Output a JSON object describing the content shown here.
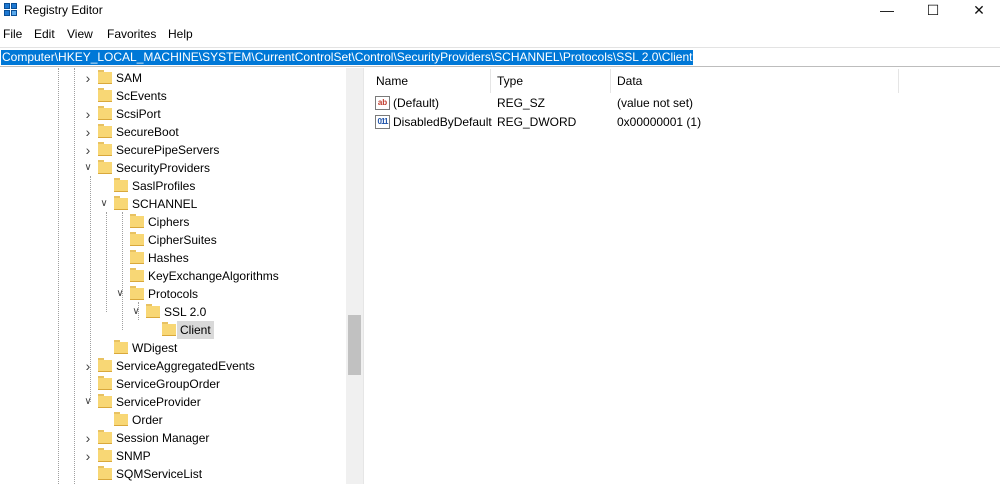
{
  "window": {
    "title": "Registry Editor",
    "minimize_glyph": "—",
    "maximize_glyph": "☐",
    "close_glyph": "✕",
    "icon": "registry-editor-icon"
  },
  "menu": {
    "file": "File",
    "edit": "Edit",
    "view": "View",
    "favorites": "Favorites",
    "help": "Help"
  },
  "address": {
    "path": "Computer\\HKEY_LOCAL_MACHINE\\SYSTEM\\CurrentControlSet\\Control\\SecurityProviders\\SCHANNEL\\Protocols\\SSL 2.0\\Client"
  },
  "tree": {
    "items": [
      {
        "label": "SAM",
        "depth": 0,
        "expander": "collapsed"
      },
      {
        "label": "ScEvents",
        "depth": 0,
        "expander": "none"
      },
      {
        "label": "ScsiPort",
        "depth": 0,
        "expander": "collapsed"
      },
      {
        "label": "SecureBoot",
        "depth": 0,
        "expander": "collapsed"
      },
      {
        "label": "SecurePipeServers",
        "depth": 0,
        "expander": "collapsed"
      },
      {
        "label": "SecurityProviders",
        "depth": 0,
        "expander": "expanded"
      },
      {
        "label": "SaslProfiles",
        "depth": 1,
        "expander": "none"
      },
      {
        "label": "SCHANNEL",
        "depth": 1,
        "expander": "expanded"
      },
      {
        "label": "Ciphers",
        "depth": 2,
        "expander": "none"
      },
      {
        "label": "CipherSuites",
        "depth": 2,
        "expander": "none"
      },
      {
        "label": "Hashes",
        "depth": 2,
        "expander": "none"
      },
      {
        "label": "KeyExchangeAlgorithms",
        "depth": 2,
        "expander": "none"
      },
      {
        "label": "Protocols",
        "depth": 2,
        "expander": "expanded"
      },
      {
        "label": "SSL 2.0",
        "depth": 3,
        "expander": "expanded"
      },
      {
        "label": "Client",
        "depth": 4,
        "expander": "none",
        "selected": true
      },
      {
        "label": "WDigest",
        "depth": 1,
        "expander": "none"
      },
      {
        "label": "ServiceAggregatedEvents",
        "depth": 0,
        "expander": "collapsed"
      },
      {
        "label": "ServiceGroupOrder",
        "depth": 0,
        "expander": "none"
      },
      {
        "label": "ServiceProvider",
        "depth": 0,
        "expander": "expanded"
      },
      {
        "label": "Order",
        "depth": 1,
        "expander": "none"
      },
      {
        "label": "Session Manager",
        "depth": 0,
        "expander": "collapsed"
      },
      {
        "label": "SNMP",
        "depth": 0,
        "expander": "collapsed"
      },
      {
        "label": "SQMServiceList",
        "depth": 0,
        "expander": "none"
      }
    ]
  },
  "values": {
    "columns": {
      "name": "Name",
      "type": "Type",
      "data": "Data"
    },
    "rows": [
      {
        "name": "(Default)",
        "type": "REG_SZ",
        "data": "(value not set)",
        "icon": "string-value-icon",
        "icon_glyph": "ab"
      },
      {
        "name": "DisabledByDefault",
        "type": "REG_DWORD",
        "data": "0x00000001 (1)",
        "icon": "binary-value-icon",
        "icon_glyph": "011"
      }
    ]
  },
  "colors": {
    "selection": "#0078d7",
    "tree_selected": "#d9d9d9",
    "folder": "#f8d775"
  }
}
